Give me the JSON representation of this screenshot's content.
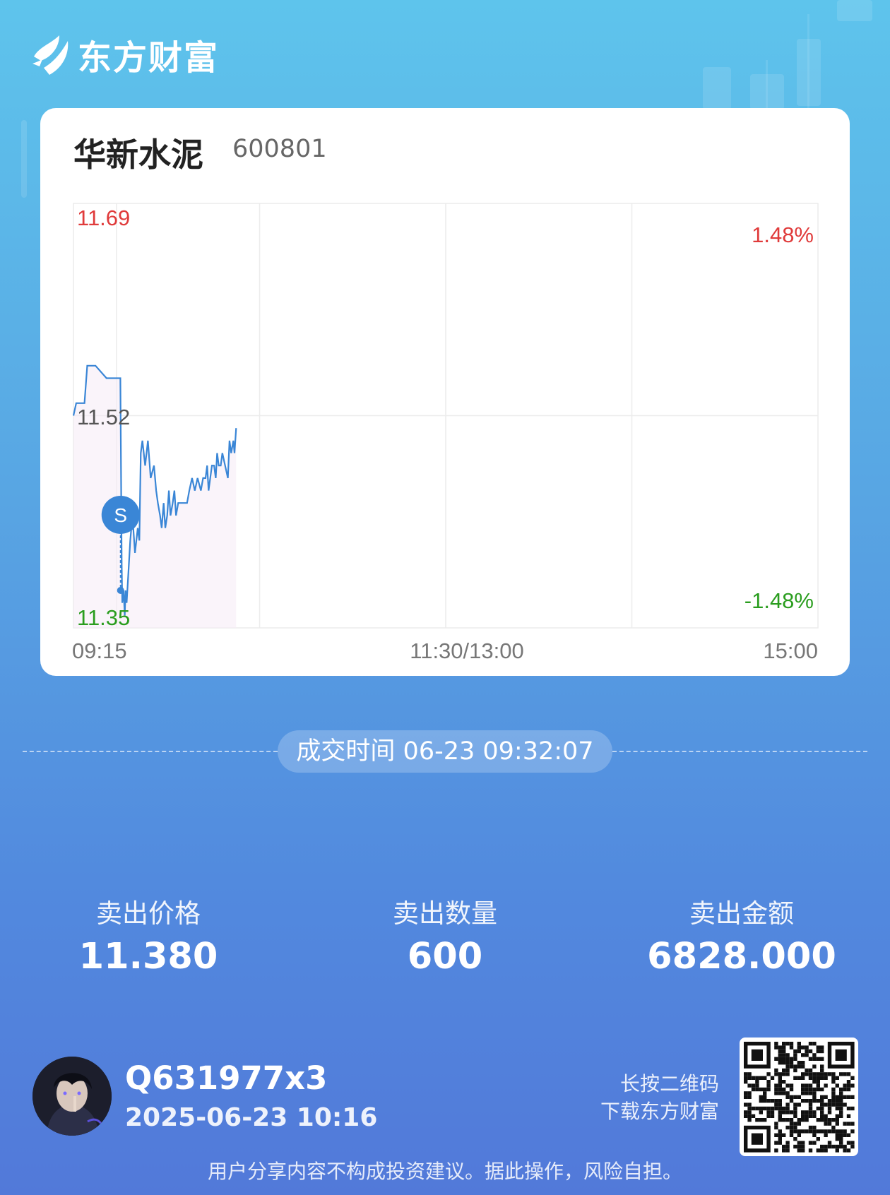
{
  "brand": {
    "name": "东方财富"
  },
  "stock": {
    "name": "华新水泥",
    "code": "600801"
  },
  "chart_data": {
    "type": "line",
    "x_tick_labels": [
      "09:15",
      "11:30/13:00",
      "15:00"
    ],
    "y_tick_labels": {
      "high": "11.69",
      "mid": "11.52",
      "low": "11.35"
    },
    "pct_labels": {
      "high": "1.48%",
      "low": "-1.48%"
    },
    "ylim": [
      11.35,
      11.69
    ],
    "prev_close": 11.52,
    "grid": true,
    "up_color": "#e03b3b",
    "down_color": "#2a9d1e",
    "line_color": "#3a86d6",
    "marker": {
      "label": "S",
      "minute": 17.1,
      "price": 11.38
    },
    "x_minutes": [
      0,
      1,
      4,
      5,
      8,
      12,
      13,
      17,
      17.5,
      17.7,
      18.2,
      18.6,
      18.9,
      19.3,
      20.6,
      21.4,
      22.3,
      23.3,
      23.9,
      24.4,
      25,
      26,
      27,
      28,
      29.2,
      30,
      30.6,
      31.4,
      32,
      32.7,
      33.3,
      34,
      34.6,
      35.2,
      36,
      36.6,
      37.2,
      38,
      39,
      40,
      41.2,
      42,
      43,
      44,
      45,
      46.2,
      47,
      47.9,
      48.5,
      49,
      50.2,
      51,
      51.6,
      52.1,
      52.7,
      53.4,
      54,
      55,
      56,
      56.6,
      57.2,
      58,
      58.4,
      59
    ],
    "y_values": [
      11.52,
      11.53,
      11.53,
      11.56,
      11.56,
      11.55,
      11.55,
      11.55,
      11.4,
      11.37,
      11.38,
      11.36,
      11.38,
      11.37,
      11.42,
      11.44,
      11.41,
      11.43,
      11.42,
      11.49,
      11.5,
      11.48,
      11.5,
      11.47,
      11.48,
      11.46,
      11.45,
      11.44,
      11.43,
      11.45,
      11.43,
      11.44,
      11.46,
      11.44,
      11.45,
      11.46,
      11.44,
      11.45,
      11.45,
      11.45,
      11.45,
      11.46,
      11.47,
      11.46,
      11.47,
      11.46,
      11.47,
      11.47,
      11.48,
      11.46,
      11.48,
      11.48,
      11.47,
      11.49,
      11.48,
      11.48,
      11.49,
      11.48,
      11.47,
      11.5,
      11.49,
      11.5,
      11.49,
      11.51
    ]
  },
  "trade": {
    "time_label": "成交时间 06-23 09:32:07"
  },
  "stats": [
    {
      "label": "卖出价格",
      "value": "11.380"
    },
    {
      "label": "卖出数量",
      "value": "600"
    },
    {
      "label": "卖出金额",
      "value": "6828.000"
    }
  ],
  "user": {
    "name": "Q631977x3",
    "datetime": "2025-06-23 10:16"
  },
  "qr": {
    "hint_line1": "长按二维码",
    "hint_line2": "下载东方财富"
  },
  "disclaimer": "用户分享内容不构成投资建议。据此操作，风险自担。"
}
